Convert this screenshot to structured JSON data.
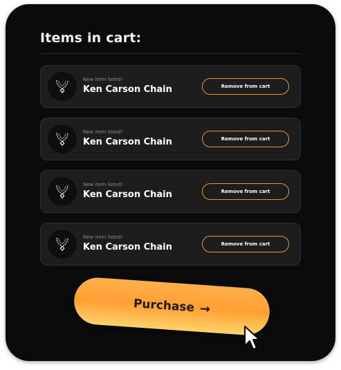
{
  "cart": {
    "title": "Items in cart:",
    "items": [
      {
        "eyebrow": "New item listed!",
        "name": "Ken Carson Chain",
        "action_label": "Remove from cart"
      },
      {
        "eyebrow": "New item listed!",
        "name": "Ken Carson Chain",
        "action_label": "Remove from cart"
      },
      {
        "eyebrow": "New item listed!",
        "name": "Ken Carson Chain",
        "action_label": "Remove from cart"
      },
      {
        "eyebrow": "New item listed!",
        "name": "Ken Carson Chain",
        "action_label": "Remove from cart"
      }
    ],
    "purchase_label": "Purchase",
    "purchase_arrow": "→"
  },
  "icons": {
    "item": "chain-necklace-icon",
    "cursor": "mouse-pointer-icon"
  },
  "colors": {
    "panel_bg": "#0b0b0b",
    "card_bg": "#1d1d1d",
    "accent_orange": "#e39a2e",
    "button_gradient_top": "#ffb04a",
    "button_gradient_bottom": "#ffd36a"
  }
}
